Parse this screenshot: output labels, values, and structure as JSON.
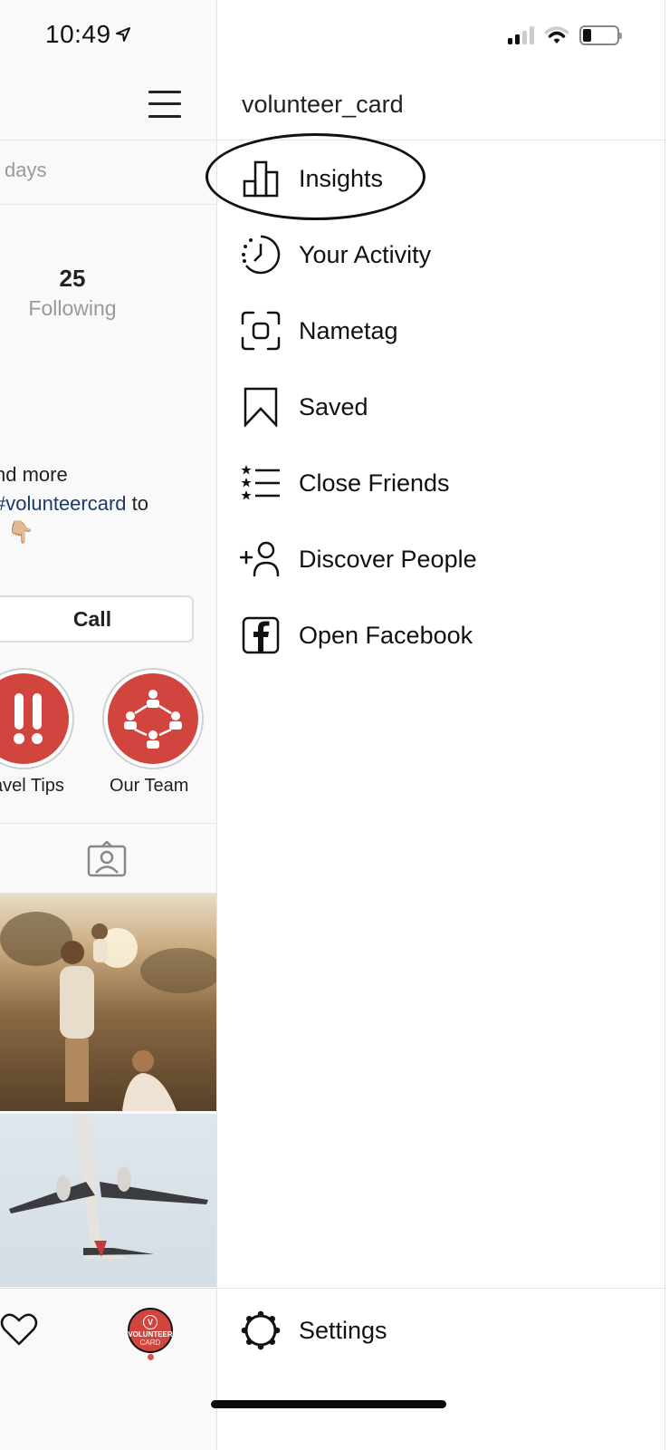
{
  "status_bar": {
    "time": "10:49",
    "location_icon": "location-arrow-icon",
    "signal_bars_active": 2,
    "signal_bars_total": 4,
    "wifi_icon": "wifi-icon",
    "battery_level_percent": 20
  },
  "profile_background": {
    "menu_icon": "hamburger-menu-icon",
    "partial_text_days": "days",
    "following": {
      "count": "25",
      "label": "Following"
    },
    "bio": {
      "line1": "nd more",
      "line2_hashtag": "#volunteercard",
      "line2_rest": " to",
      "line3_emoji": "👇🏼"
    },
    "call_button": "Call",
    "highlights": [
      {
        "label": "avel Tips",
        "icon": "double-exclamation-icon"
      },
      {
        "label": "Our Team",
        "icon": "team-network-icon"
      }
    ],
    "tagged_tab_icon": "tagged-user-icon",
    "photos": [
      {
        "description": "family-in-field-photo"
      },
      {
        "description": "airplane-taking-off-photo"
      }
    ],
    "tab_bar": {
      "heart_icon": "heart-icon",
      "avatar": {
        "top": "VOLUNTEER",
        "bottom": "CARD",
        "monogram": "V"
      },
      "notification_dot_color": "#d9534f"
    }
  },
  "drawer": {
    "username": "volunteer_card",
    "menu_items": [
      {
        "label": "Insights",
        "icon": "bar-chart-icon",
        "annotated": true
      },
      {
        "label": "Your Activity",
        "icon": "activity-clock-icon"
      },
      {
        "label": "Nametag",
        "icon": "nametag-scan-icon"
      },
      {
        "label": "Saved",
        "icon": "bookmark-icon"
      },
      {
        "label": "Close Friends",
        "icon": "close-friends-list-icon"
      },
      {
        "label": "Discover People",
        "icon": "add-person-icon"
      },
      {
        "label": "Open Facebook",
        "icon": "facebook-icon"
      }
    ],
    "settings": {
      "label": "Settings",
      "icon": "settings-gear-icon"
    }
  },
  "colors": {
    "brand_red": "#d2453f",
    "hashtag_blue": "#1c3a6b",
    "muted_text": "#999999"
  }
}
